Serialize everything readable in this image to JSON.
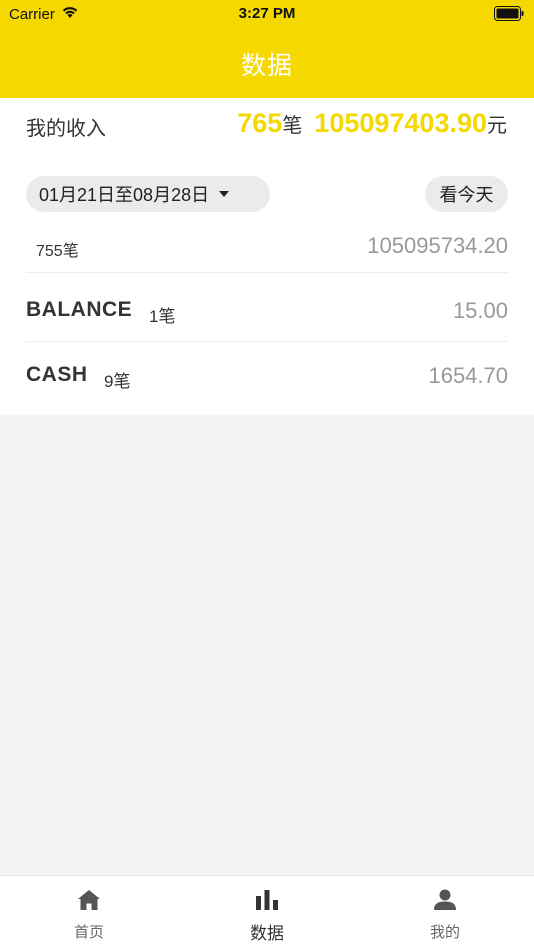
{
  "status_bar": {
    "carrier": "Carrier",
    "time": "3:27 PM"
  },
  "nav": {
    "title": "数据"
  },
  "income": {
    "label": "我的收入",
    "count": "765",
    "count_unit": "笔",
    "amount": "105097403.90",
    "amount_unit": "元"
  },
  "filters": {
    "date_range": "01月21日至08月28日",
    "today_button": "看今天"
  },
  "rows": [
    {
      "left": "755笔",
      "right": "105095734.20"
    }
  ],
  "methods": [
    {
      "name": "BALANCE",
      "count": "1笔",
      "amount": "15.00"
    },
    {
      "name": "CASH",
      "count": "9笔",
      "amount": "1654.70"
    }
  ],
  "tabs": [
    {
      "label": "首页",
      "icon": "home-icon"
    },
    {
      "label": "数据",
      "icon": "bar-chart-icon"
    },
    {
      "label": "我的",
      "icon": "user-icon"
    }
  ],
  "colors": {
    "accent": "#f4d800",
    "muted": "#999999"
  }
}
